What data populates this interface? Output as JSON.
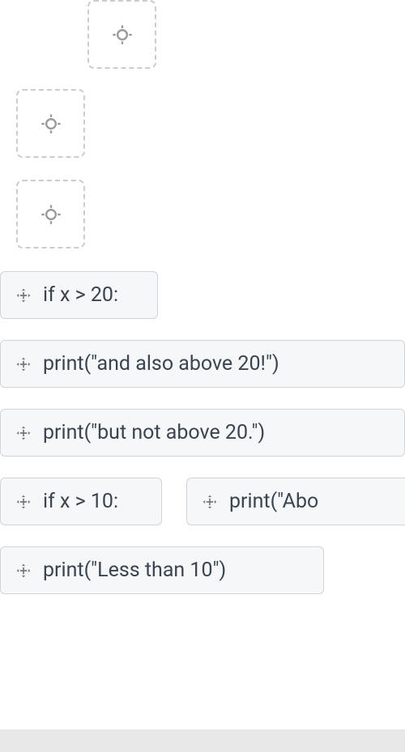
{
  "blocks": {
    "b1": "if x > 20:",
    "b2": "print(\"and also above 20!\")",
    "b3": "print(\"but not above 20.\")",
    "b4": "if x > 10:",
    "b5": "print(\"Abo",
    "b6": "print(\"Less than 10\")"
  }
}
